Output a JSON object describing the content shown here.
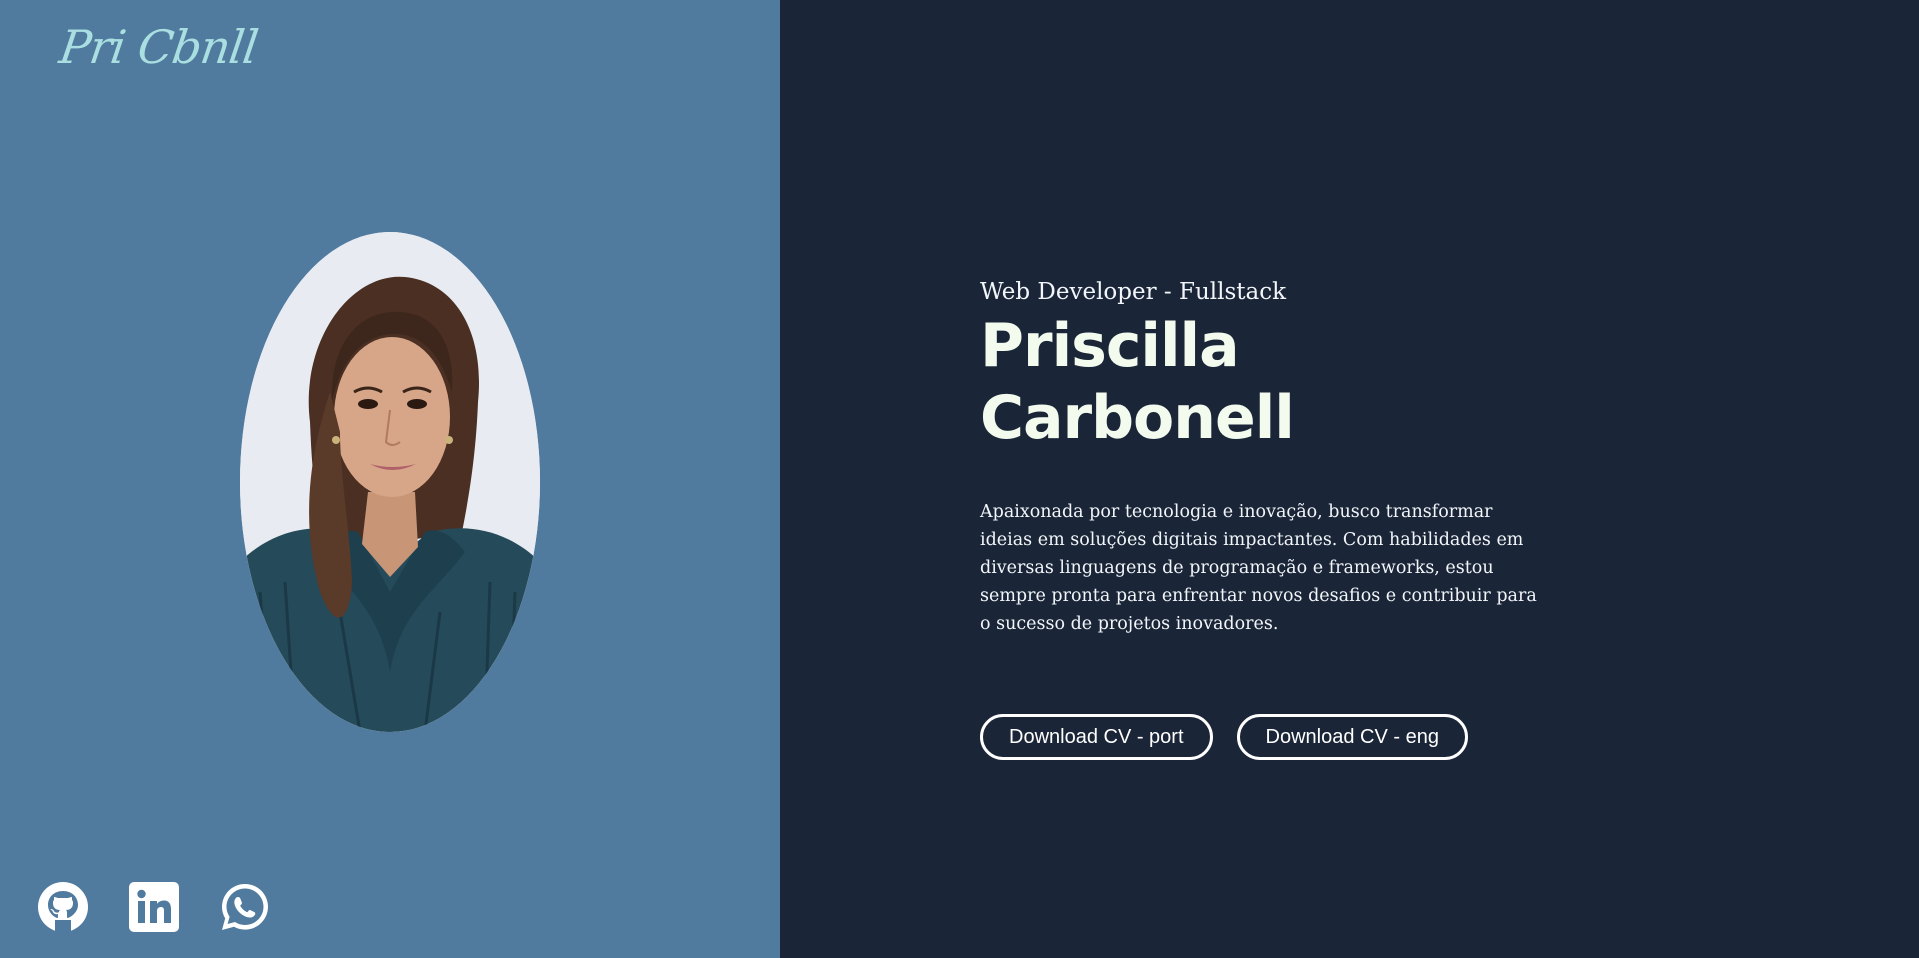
{
  "brand": {
    "logo_text": "Pri Cbnll",
    "logo_color": "#a9dfe1"
  },
  "hero": {
    "subtitle": "Web Developer - Fullstack",
    "name": "Priscilla Carbonell",
    "bio": "Apaixonada por tecnologia e inovação, busco transformar ideias em soluções digitais impactantes. Com habilidades em diversas linguagens de programação e frameworks, estou sempre pronta para enfrentar novos desafios e contribuir para o sucesso de projetos inovadores."
  },
  "buttons": {
    "cv_port_label": "Download CV - port",
    "cv_eng_label": "Download CV - eng"
  },
  "social": [
    {
      "icon": "github-icon"
    },
    {
      "icon": "linkedin-icon"
    },
    {
      "icon": "whatsapp-icon"
    }
  ],
  "colors": {
    "left_bg": "#517a9f",
    "right_bg": "#1a2537",
    "name_color": "#f3fbef"
  }
}
